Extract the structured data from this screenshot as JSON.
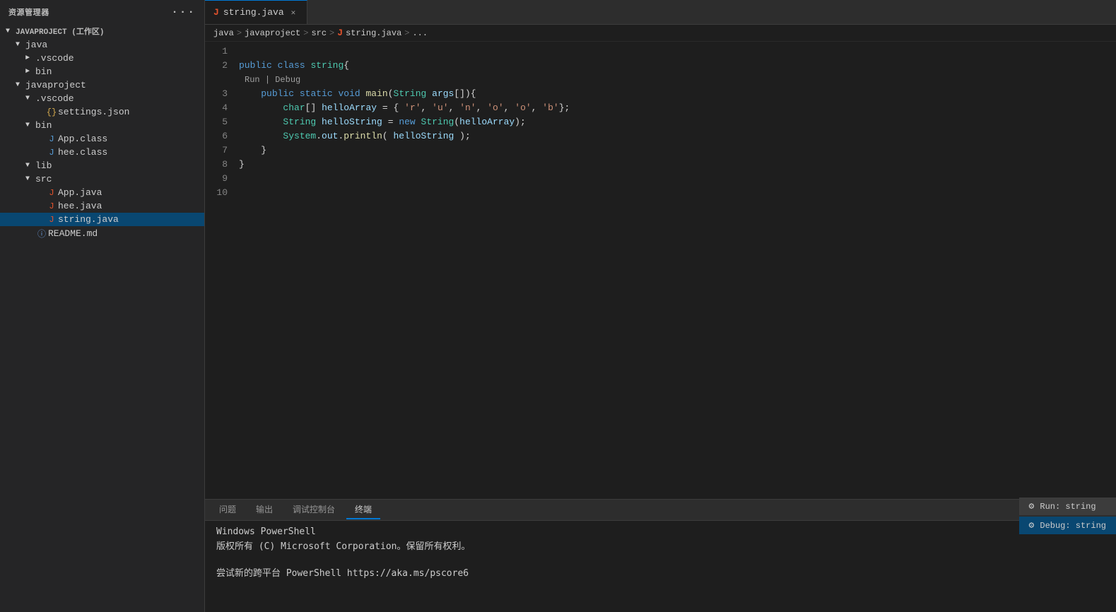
{
  "sidebar": {
    "header": "资源管理器",
    "dots": "···",
    "project": {
      "label": "JAVAPROJECT (工作区)",
      "items": [
        {
          "id": "java",
          "label": "java",
          "indent": 1,
          "type": "folder",
          "open": true
        },
        {
          "id": "vscode1",
          "label": ".vscode",
          "indent": 2,
          "type": "folder-closed"
        },
        {
          "id": "bin1",
          "label": "bin",
          "indent": 2,
          "type": "folder-closed"
        },
        {
          "id": "javaproject",
          "label": "javaproject",
          "indent": 1,
          "type": "folder",
          "open": true
        },
        {
          "id": "vscode2",
          "label": ".vscode",
          "indent": 2,
          "type": "folder",
          "open": true
        },
        {
          "id": "settings-json",
          "label": "settings.json",
          "indent": 3,
          "type": "json"
        },
        {
          "id": "bin2",
          "label": "bin",
          "indent": 2,
          "type": "folder",
          "open": true
        },
        {
          "id": "app-class",
          "label": "App.class",
          "indent": 3,
          "type": "class"
        },
        {
          "id": "hee-class",
          "label": "hee.class",
          "indent": 3,
          "type": "class"
        },
        {
          "id": "lib",
          "label": "lib",
          "indent": 2,
          "type": "folder",
          "open": false
        },
        {
          "id": "src",
          "label": "src",
          "indent": 2,
          "type": "folder",
          "open": true
        },
        {
          "id": "app-java",
          "label": "App.java",
          "indent": 3,
          "type": "java"
        },
        {
          "id": "hee-java",
          "label": "hee.java",
          "indent": 3,
          "type": "java"
        },
        {
          "id": "string-java",
          "label": "string.java",
          "indent": 3,
          "type": "java",
          "active": true
        },
        {
          "id": "readme",
          "label": "README.md",
          "indent": 2,
          "type": "md"
        }
      ]
    }
  },
  "tabs": [
    {
      "id": "string-java-tab",
      "label": "string.java",
      "active": true,
      "icon": "J"
    }
  ],
  "breadcrumb": {
    "parts": [
      "java",
      "javaproject",
      "src",
      "string.java",
      "..."
    ]
  },
  "code": {
    "run_debug": "Run | Debug",
    "lines": [
      {
        "num": 1,
        "content": ""
      },
      {
        "num": 2,
        "content": "public class string{"
      },
      {
        "num": 3,
        "content": "    public static void main(String args[]){"
      },
      {
        "num": 4,
        "content": "        char[] helloArray = { 'r', 'u', 'n', 'o', 'o', 'b'};"
      },
      {
        "num": 5,
        "content": "        String helloString = new String(helloArray);"
      },
      {
        "num": 6,
        "content": "        System.out.println( helloString );"
      },
      {
        "num": 7,
        "content": "    }"
      },
      {
        "num": 8,
        "content": "}"
      },
      {
        "num": 9,
        "content": ""
      },
      {
        "num": 10,
        "content": ""
      }
    ]
  },
  "panel": {
    "tabs": [
      "问题",
      "输出",
      "调试控制台",
      "终端"
    ],
    "active_tab": "终端",
    "terminal_lines": [
      "Windows PowerShell",
      "版权所有 (C) Microsoft Corporation。保留所有权利。",
      "",
      "尝试新的跨平台 PowerShell https://aka.ms/pscore6"
    ]
  },
  "run_debug_float": {
    "run_label": "Run: string",
    "debug_label": "Debug: string",
    "icon": "⚙"
  }
}
